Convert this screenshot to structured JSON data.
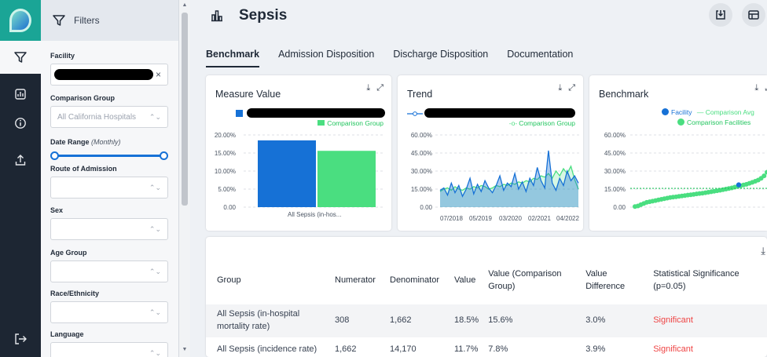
{
  "app": {
    "title": "Sepsis"
  },
  "filters": {
    "heading": "Filters",
    "facility": {
      "label": "Facility",
      "value": ""
    },
    "comparison_group": {
      "label": "Comparison Group",
      "value": "All California Hospitals"
    },
    "date_range": {
      "label": "Date Range",
      "qualifier": "(Monthly)"
    },
    "route": {
      "label": "Route of Admission",
      "value": ""
    },
    "sex": {
      "label": "Sex",
      "value": ""
    },
    "age": {
      "label": "Age Group",
      "value": ""
    },
    "race": {
      "label": "Race/Ethnicity",
      "value": ""
    },
    "language": {
      "label": "Language",
      "value": ""
    }
  },
  "tabs": [
    {
      "label": "Benchmark",
      "active": true
    },
    {
      "label": "Admission Disposition",
      "active": false
    },
    {
      "label": "Discharge Disposition",
      "active": false
    },
    {
      "label": "Documentation",
      "active": false
    }
  ],
  "cards": {
    "measure": {
      "title": "Measure Value",
      "legend": "Comparison Group"
    },
    "trend": {
      "title": "Trend",
      "legend": "Comparison Group"
    },
    "benchmark": {
      "title": "Benchmark",
      "legend_facility": "Facility",
      "legend_avg": "Comparison Avg",
      "legend_facilities": "Comparison Facilities"
    }
  },
  "chart_data": [
    {
      "type": "bar",
      "title": "Measure Value",
      "categories": [
        "All Sepsis (in-hos..."
      ],
      "series": [
        {
          "name": "",
          "color": "#1671d6",
          "values": [
            18.5
          ]
        },
        {
          "name": "Comparison Group",
          "color": "#4ade80",
          "values": [
            15.6
          ]
        }
      ],
      "yticks": [
        "0.00",
        "5.00%",
        "10.00%",
        "15.00%",
        "20.00%"
      ],
      "ylim": [
        0,
        20
      ]
    },
    {
      "type": "area",
      "title": "Trend",
      "xticks": [
        "07/2018",
        "05/2019",
        "03/2020",
        "02/2021",
        "04/2022"
      ],
      "yticks": [
        "0.00",
        "15.00%",
        "30.00%",
        "45.00%",
        "60.00%"
      ],
      "ylim": [
        0,
        60
      ],
      "series": [
        {
          "name": "",
          "color": "#1671d6",
          "values": [
            14,
            16,
            10,
            20,
            12,
            18,
            9,
            15,
            24,
            11,
            19,
            13,
            22,
            16,
            12,
            18,
            26,
            14,
            20,
            17,
            28,
            15,
            21,
            13,
            24,
            18,
            33,
            22,
            16,
            47,
            20,
            14,
            24,
            18,
            30,
            22,
            26,
            20
          ]
        },
        {
          "name": "Comparison Group",
          "color": "#4ade80",
          "values": [
            13,
            15,
            16,
            14,
            17,
            15,
            14,
            16,
            15,
            17,
            16,
            18,
            17,
            15,
            16,
            18,
            17,
            19,
            18,
            20,
            19,
            21,
            20,
            22,
            21,
            24,
            23,
            26,
            25,
            28,
            24,
            30,
            26,
            32,
            28,
            34,
            23,
            15
          ]
        }
      ]
    },
    {
      "type": "scatter",
      "title": "Benchmark",
      "yticks": [
        "0.00",
        "15.00%",
        "30.00%",
        "45.00%",
        "60.00%"
      ],
      "ylim": [
        0,
        60
      ],
      "comparison_avg": 15.6,
      "facility_value": 18.5,
      "series": [
        {
          "name": "Comparison Facilities",
          "color": "#4ade80",
          "values": [
            0.5,
            1,
            2,
            3,
            4,
            4.5,
            5,
            5.5,
            6,
            6.5,
            7,
            7.5,
            8,
            8.3,
            8.6,
            9,
            9.3,
            9.6,
            10,
            10.3,
            10.6,
            11,
            11.3,
            11.6,
            12,
            12.4,
            12.8,
            13.2,
            13.6,
            14,
            14.5,
            15,
            15.5,
            16,
            16.6,
            17.2,
            17.8,
            18.4,
            19,
            19.8,
            20.6,
            21.5,
            22.5,
            24,
            26,
            29
          ]
        }
      ]
    }
  ],
  "table": {
    "headers": [
      "Group",
      "Numerator",
      "Denominator",
      "Value",
      "Value (Comparison Group)",
      "Value Difference",
      "Statistical Significance (p=0.05)"
    ],
    "rows": [
      [
        "All Sepsis (in-hospital mortality rate)",
        "308",
        "1,662",
        "18.5%",
        "15.6%",
        "3.0%",
        "Significant"
      ],
      [
        "All Sepsis (incidence rate)",
        "1,662",
        "14,170",
        "11.7%",
        "7.8%",
        "3.9%",
        "Significant"
      ]
    ]
  }
}
